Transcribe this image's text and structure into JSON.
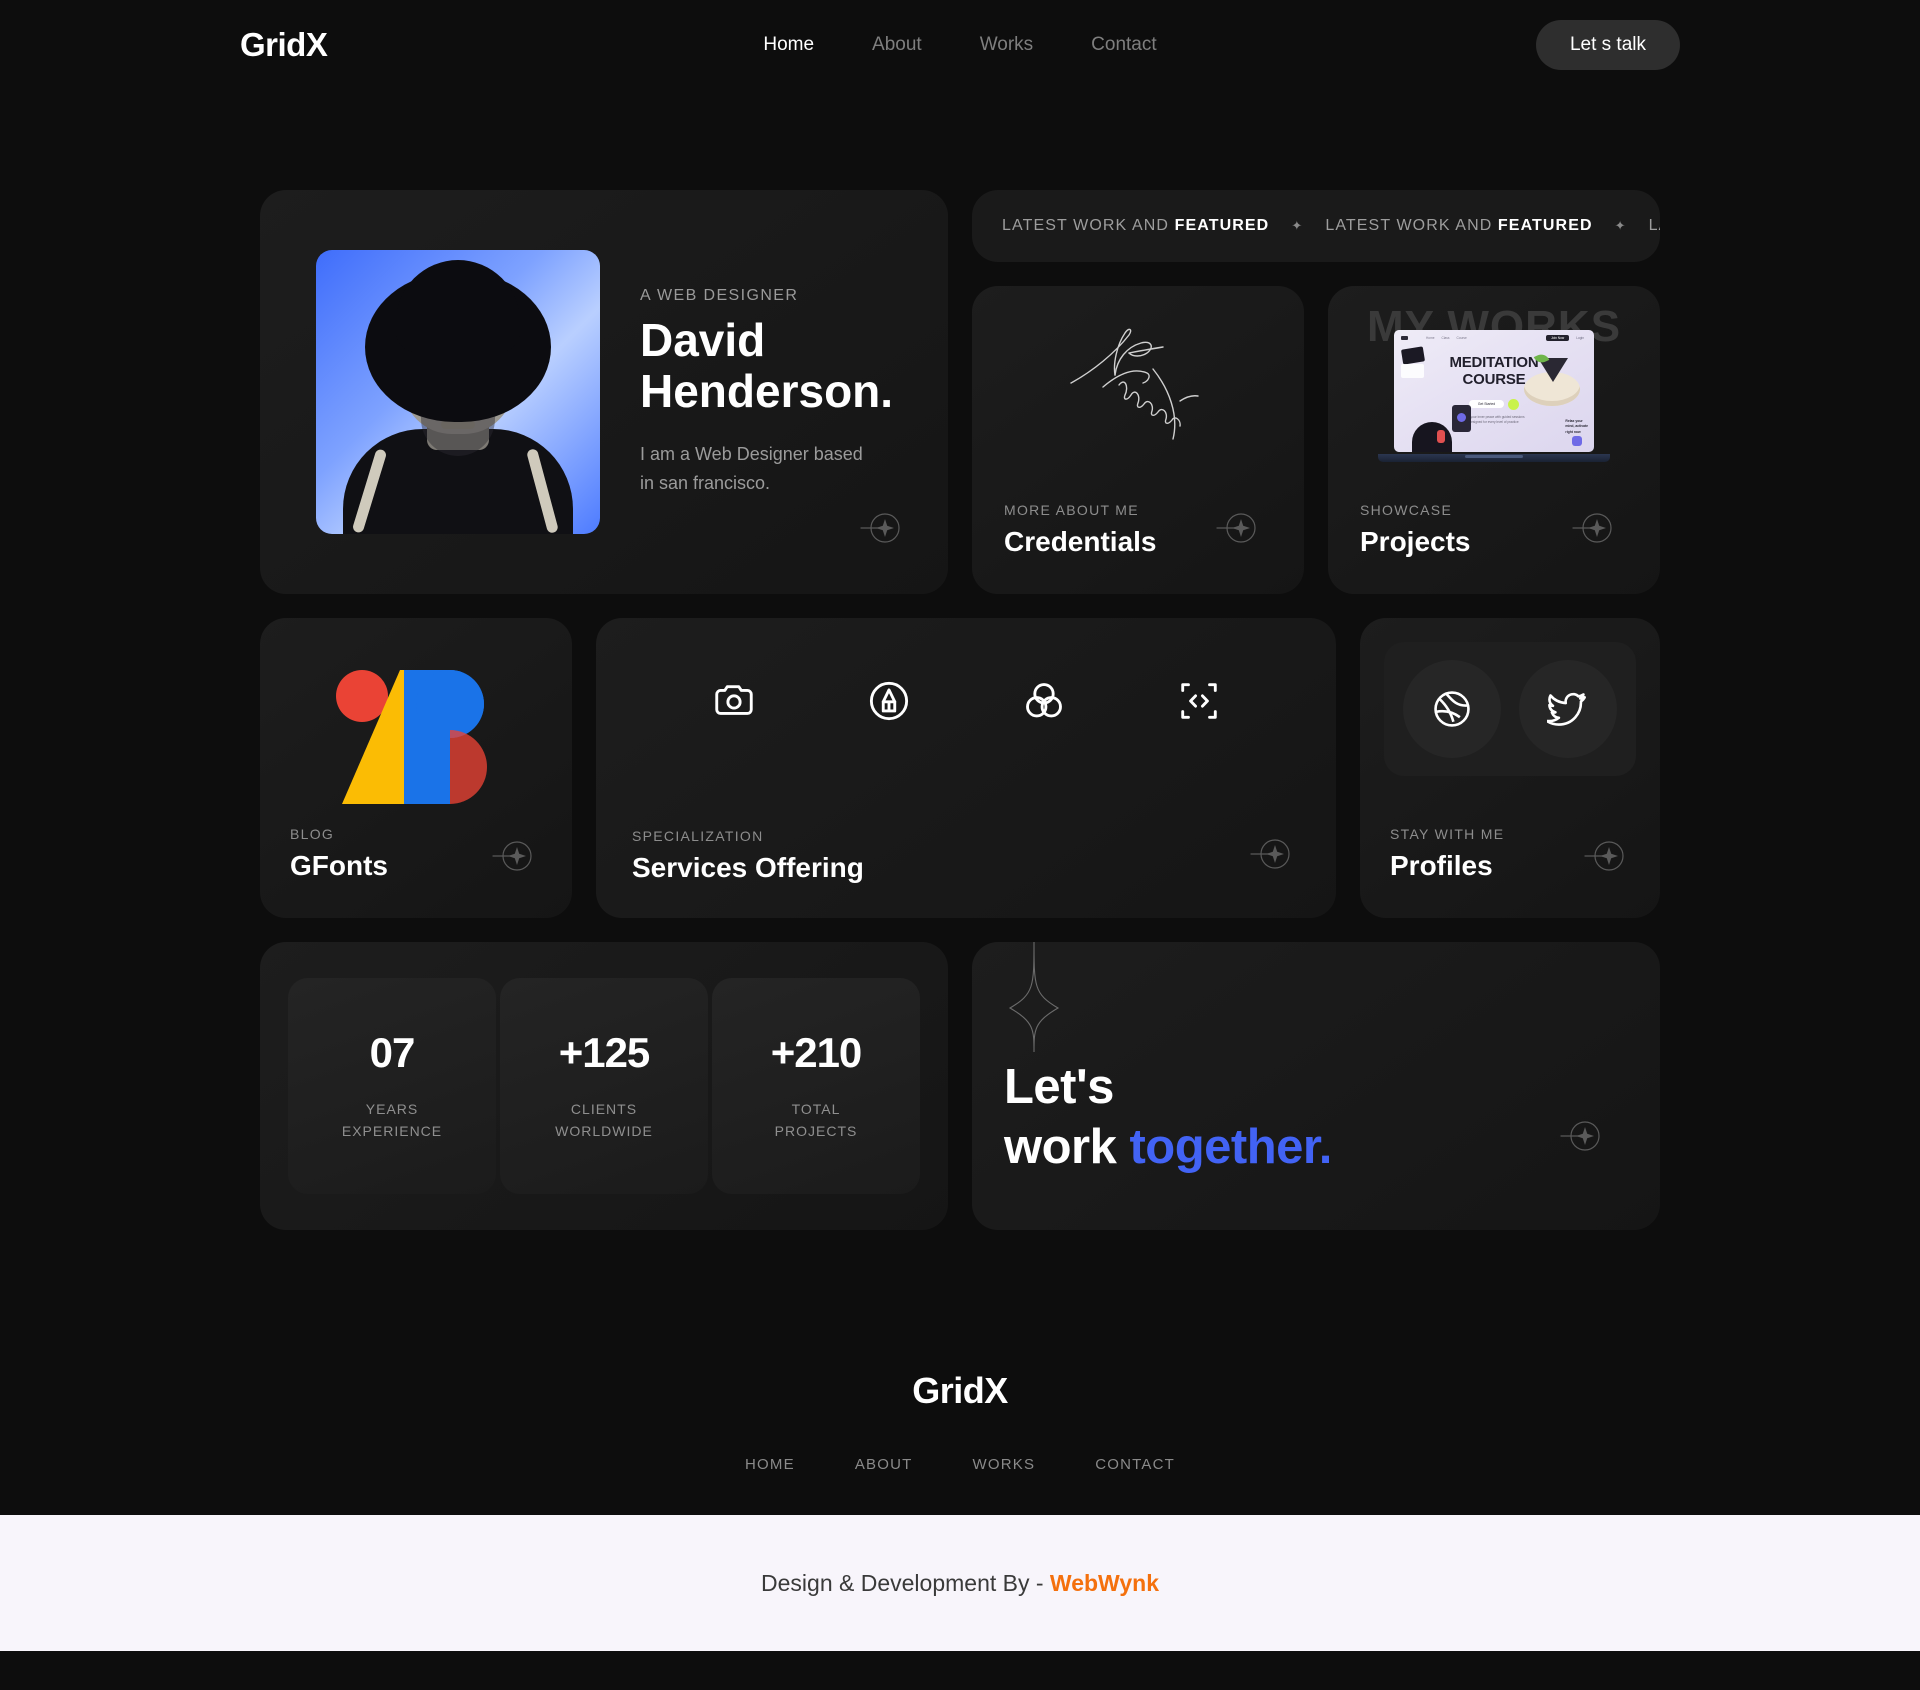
{
  "header": {
    "brand": "GridX",
    "nav": [
      {
        "label": "Home",
        "active": true
      },
      {
        "label": "About",
        "active": false
      },
      {
        "label": "Works",
        "active": false
      },
      {
        "label": "Contact",
        "active": false
      }
    ],
    "cta_label": "Let s talk"
  },
  "hero": {
    "eyebrow": "A WEB DESIGNER",
    "name_line1": "David",
    "name_line2": "Henderson.",
    "desc_line1": "I am a Web Designer based",
    "desc_line2": "in san francisco."
  },
  "marquee": {
    "items": [
      {
        "text": "LATEST WORK AND ",
        "bold": "FEATURED"
      },
      {
        "text": "LATEST WORK AND ",
        "bold": "FEATURED"
      },
      {
        "text": "LATEST WORK AN",
        "bold": ""
      }
    ],
    "separator": "✦"
  },
  "cards": {
    "credentials": {
      "label": "MORE ABOUT ME",
      "title": "Credentials"
    },
    "projects": {
      "label": "SHOWCASE",
      "title": "Projects",
      "bg_text": "MY WORKS"
    },
    "gfonts": {
      "label": "BLOG",
      "title": "GFonts"
    },
    "services": {
      "label": "SPECIALIZATION",
      "title": "Services Offering"
    },
    "profiles": {
      "label": "STAY WITH ME",
      "title": "Profiles"
    }
  },
  "laptop": {
    "title_line1": "MEDITATION",
    "title_line2": "COURSE",
    "nav": [
      "Home",
      "Class",
      "Course"
    ],
    "cta_pill": "Join Now",
    "cta_pill2": "Login",
    "button": "Get Started",
    "sub_line1": "Find your inner peace with guided sessions",
    "sub_line2": "designed for every level of practice",
    "side_line1": "Relax your",
    "side_line2": "mind, activate",
    "side_line3": "right now"
  },
  "services_icons": [
    "camera-icon",
    "pen-nib-icon",
    "color-circles-icon",
    "code-frame-icon"
  ],
  "profiles_icons": [
    "dribbble-icon",
    "twitter-icon"
  ],
  "stats": [
    {
      "value": "07",
      "label_line1": "YEARS",
      "label_line2": "EXPERIENCE"
    },
    {
      "value": "+125",
      "label_line1": "CLIENTS",
      "label_line2": "WORLDWIDE"
    },
    {
      "value": "+210",
      "label_line1": "TOTAL",
      "label_line2": "PROJECTS"
    }
  ],
  "cta": {
    "line1": "Let's",
    "line2_plain": "work ",
    "line2_accent": "together."
  },
  "footer": {
    "brand": "GridX",
    "links": [
      "HOME",
      "ABOUT",
      "WORKS",
      "CONTACT"
    ]
  },
  "credit": {
    "text": "Design & Development  By - ",
    "brand": "WebWynk"
  },
  "colors": {
    "background": "#0d0d0d",
    "card": "#1a1a1a",
    "accent_blue": "#4263f5",
    "credit_bar": "#f8f5fb",
    "credit_brand": "#f4700d"
  }
}
